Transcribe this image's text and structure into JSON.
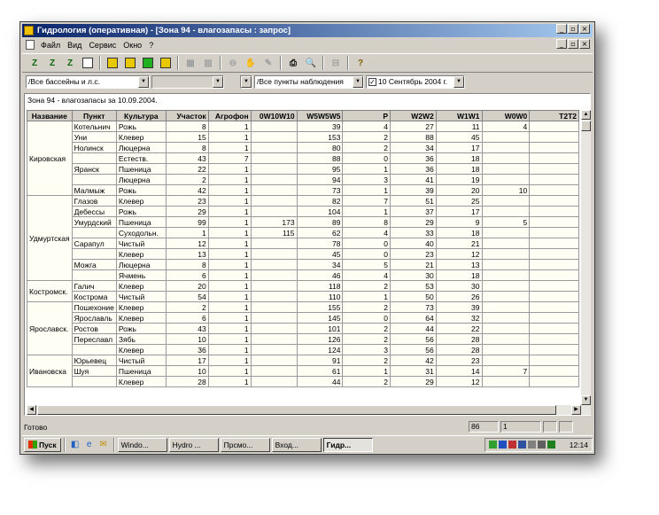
{
  "window": {
    "title": "Гидрология (оперативная) - [Зона 94 - влагозапасы : запрос]"
  },
  "menu": [
    "Файл",
    "Вид",
    "Сервис",
    "Окно",
    "?"
  ],
  "filters": {
    "basin": "/Все бассейны и л.с.",
    "second": "",
    "third": "",
    "stations": "/Все пункты наблюдения",
    "date": "10 Сентябрь 2004 г."
  },
  "caption": "Зона 94 - влагозапасы за 10.09.2004.",
  "table": {
    "columns": [
      "Название",
      "Пункт",
      "Культура",
      "Участок",
      "Агрофон",
      "0W10W10",
      "W5W5W5",
      "P",
      "W2W2",
      "W1W1",
      "W0W0",
      "T2T2"
    ],
    "groups": [
      {
        "region": "Кировская",
        "rows": [
          [
            "Котельнич",
            "Рожь",
            "8",
            "1",
            "",
            "39",
            "4",
            "27",
            "11",
            "4",
            ""
          ],
          [
            "Уни",
            "Клевер",
            "15",
            "1",
            "",
            "153",
            "2",
            "88",
            "45",
            "",
            ""
          ],
          [
            "Нолинск",
            "Люцерна",
            "8",
            "1",
            "",
            "80",
            "2",
            "34",
            "17",
            "",
            ""
          ],
          [
            "",
            "Естеств.",
            "43",
            "7",
            "",
            "88",
            "0",
            "36",
            "18",
            "",
            ""
          ],
          [
            "Яранск",
            "Пшеница",
            "22",
            "1",
            "",
            "95",
            "1",
            "36",
            "18",
            "",
            ""
          ],
          [
            "",
            "Люцерна",
            "2",
            "1",
            "",
            "94",
            "3",
            "41",
            "19",
            "",
            ""
          ],
          [
            "Малмыж",
            "Рожь",
            "42",
            "1",
            "",
            "73",
            "1",
            "39",
            "20",
            "10",
            ""
          ]
        ]
      },
      {
        "region": "Удмуртская",
        "rows": [
          [
            "Глазов",
            "Клевер",
            "23",
            "1",
            "",
            "82",
            "7",
            "51",
            "25",
            "",
            ""
          ],
          [
            "Дебессы",
            "Рожь",
            "29",
            "1",
            "",
            "104",
            "1",
            "37",
            "17",
            "",
            ""
          ],
          [
            "Умурдский",
            "Пшеница",
            "99",
            "1",
            "173",
            "89",
            "8",
            "29",
            "9",
            "5",
            ""
          ],
          [
            "",
            "Суходольн.",
            "1",
            "1",
            "115",
            "62",
            "4",
            "33",
            "18",
            "",
            ""
          ],
          [
            "Сарапул",
            "Чистый",
            "12",
            "1",
            "",
            "78",
            "0",
            "40",
            "21",
            "",
            ""
          ],
          [
            "",
            "Клевер",
            "13",
            "1",
            "",
            "45",
            "0",
            "23",
            "12",
            "",
            ""
          ],
          [
            "Можга",
            "Люцерна",
            "8",
            "1",
            "",
            "34",
            "5",
            "21",
            "13",
            "",
            ""
          ],
          [
            "",
            "Ячмень",
            "6",
            "1",
            "",
            "46",
            "4",
            "30",
            "18",
            "",
            ""
          ]
        ]
      },
      {
        "region": "Костромск.",
        "rows": [
          [
            "Галич",
            "Клевер",
            "20",
            "1",
            "",
            "118",
            "2",
            "53",
            "30",
            "",
            ""
          ],
          [
            "Кострома",
            "Чистый",
            "54",
            "1",
            "",
            "110",
            "1",
            "50",
            "26",
            "",
            ""
          ]
        ]
      },
      {
        "region": "Ярославск.",
        "rows": [
          [
            "Пошехоние",
            "Клевер",
            "2",
            "1",
            "",
            "155",
            "2",
            "73",
            "39",
            "",
            ""
          ],
          [
            "Ярославль",
            "Клевер",
            "6",
            "1",
            "",
            "145",
            "0",
            "64",
            "32",
            "",
            ""
          ],
          [
            "Ростов",
            "Рожь",
            "43",
            "1",
            "",
            "101",
            "2",
            "44",
            "22",
            "",
            ""
          ],
          [
            "Переславл",
            "Зябь",
            "10",
            "1",
            "",
            "126",
            "2",
            "56",
            "28",
            "",
            ""
          ],
          [
            "",
            "Клевер",
            "36",
            "1",
            "",
            "124",
            "3",
            "56",
            "28",
            "",
            ""
          ]
        ]
      },
      {
        "region": "Ивановска",
        "rows": [
          [
            "Юрьевец",
            "Чистый",
            "17",
            "1",
            "",
            "91",
            "2",
            "42",
            "23",
            "",
            ""
          ],
          [
            "Шуя",
            "Пшеница",
            "10",
            "1",
            "",
            "61",
            "1",
            "31",
            "14",
            "7",
            ""
          ],
          [
            "",
            "Клевер",
            "28",
            "1",
            "",
            "44",
            "2",
            "29",
            "12",
            "",
            ""
          ]
        ]
      }
    ]
  },
  "status": {
    "text": "Готово",
    "pane1": "86",
    "pane2": "1"
  },
  "taskbar": {
    "start": "Пуск",
    "tasks": [
      "Windo...",
      "Hydro ...",
      "Прсмо...",
      "Вход...",
      "Гидр..."
    ],
    "clock": "12:14"
  },
  "toolbar_glyphs": {
    "new": "🗋",
    "print": "🖶",
    "preview": "🔍",
    "help": "?"
  }
}
